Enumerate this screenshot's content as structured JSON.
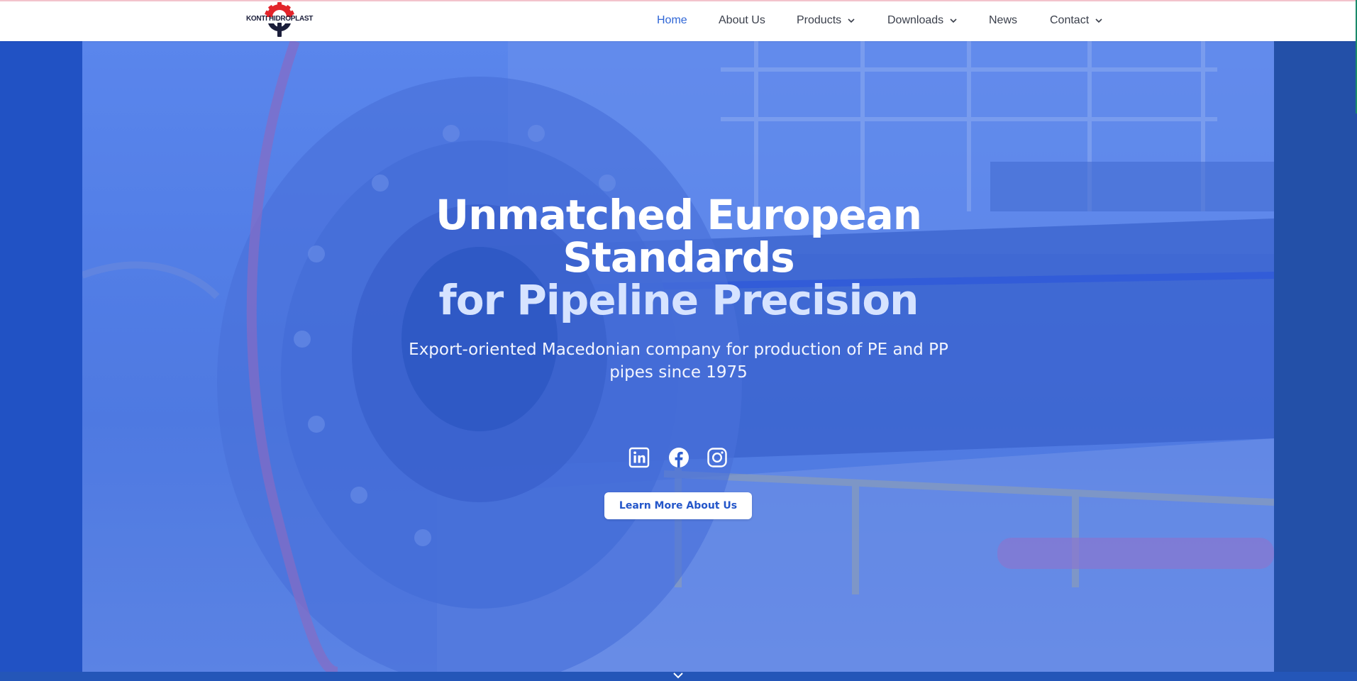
{
  "brand": {
    "logo_text": "KONTI HIDROPLAST",
    "logo_icon": "gear-pipe-logo-icon",
    "red": "#e2232a",
    "navy": "#1b1e3a"
  },
  "nav": {
    "items": [
      {
        "label": "Home",
        "active": true
      },
      {
        "label": "About Us",
        "active": false
      },
      {
        "label": "Products",
        "active": false,
        "dropdown": true
      },
      {
        "label": "Downloads",
        "active": false,
        "dropdown": true
      },
      {
        "label": "News",
        "active": false
      },
      {
        "label": "Contact",
        "active": false,
        "dropdown": true
      }
    ],
    "active_color": "#2f66d6",
    "chevron_icon": "chevron-down-icon"
  },
  "hero": {
    "title_line1": "Unmatched European Standards",
    "title_line2": "for Pipeline Precision",
    "subtitle": "Export-oriented Macedonian company for production of PE and PP pipes since 1975",
    "socials": [
      {
        "name": "linkedin-icon"
      },
      {
        "name": "facebook-icon"
      },
      {
        "name": "instagram-icon"
      }
    ],
    "cta_label": "Learn More About Us",
    "scroll_icon": "chevron-down-icon",
    "overlay_color": "#2152c4"
  }
}
